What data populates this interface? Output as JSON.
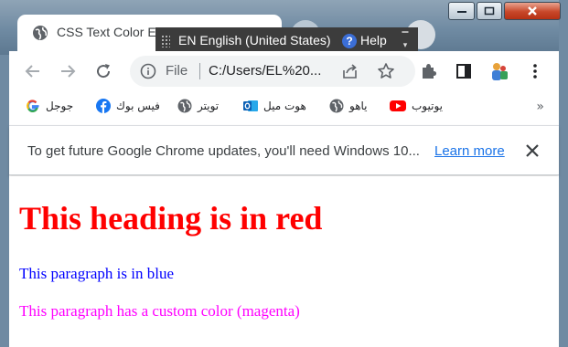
{
  "tab": {
    "title": "CSS Text Color Ex"
  },
  "language_bar": {
    "language": "EN English (United States)",
    "help": "Help"
  },
  "omnibox": {
    "scheme_label": "File",
    "url": "C:/Users/EL%20..."
  },
  "bookmarks": [
    {
      "label": "جوجل",
      "icon": "google-icon"
    },
    {
      "label": "فيس بوك",
      "icon": "facebook-icon"
    },
    {
      "label": "تويتر",
      "icon": "globe-icon"
    },
    {
      "label": "هوت ميل",
      "icon": "outlook-icon"
    },
    {
      "label": "ياهو",
      "icon": "globe-icon"
    },
    {
      "label": "يوتيوب",
      "icon": "youtube-icon"
    }
  ],
  "bookmarks_more": "»",
  "infobar": {
    "message": "To get future Google Chrome updates, you'll need Windows 10...",
    "link": "Learn more"
  },
  "page": {
    "heading": "This heading is in red",
    "paragraph_blue": "This paragraph is in blue",
    "paragraph_magenta": "This paragraph has a custom color (magenta)"
  },
  "colors": {
    "heading": "#ff0000",
    "paragraph_blue": "#0000ff",
    "paragraph_magenta": "#ff00ff",
    "link": "#1a73e8"
  }
}
